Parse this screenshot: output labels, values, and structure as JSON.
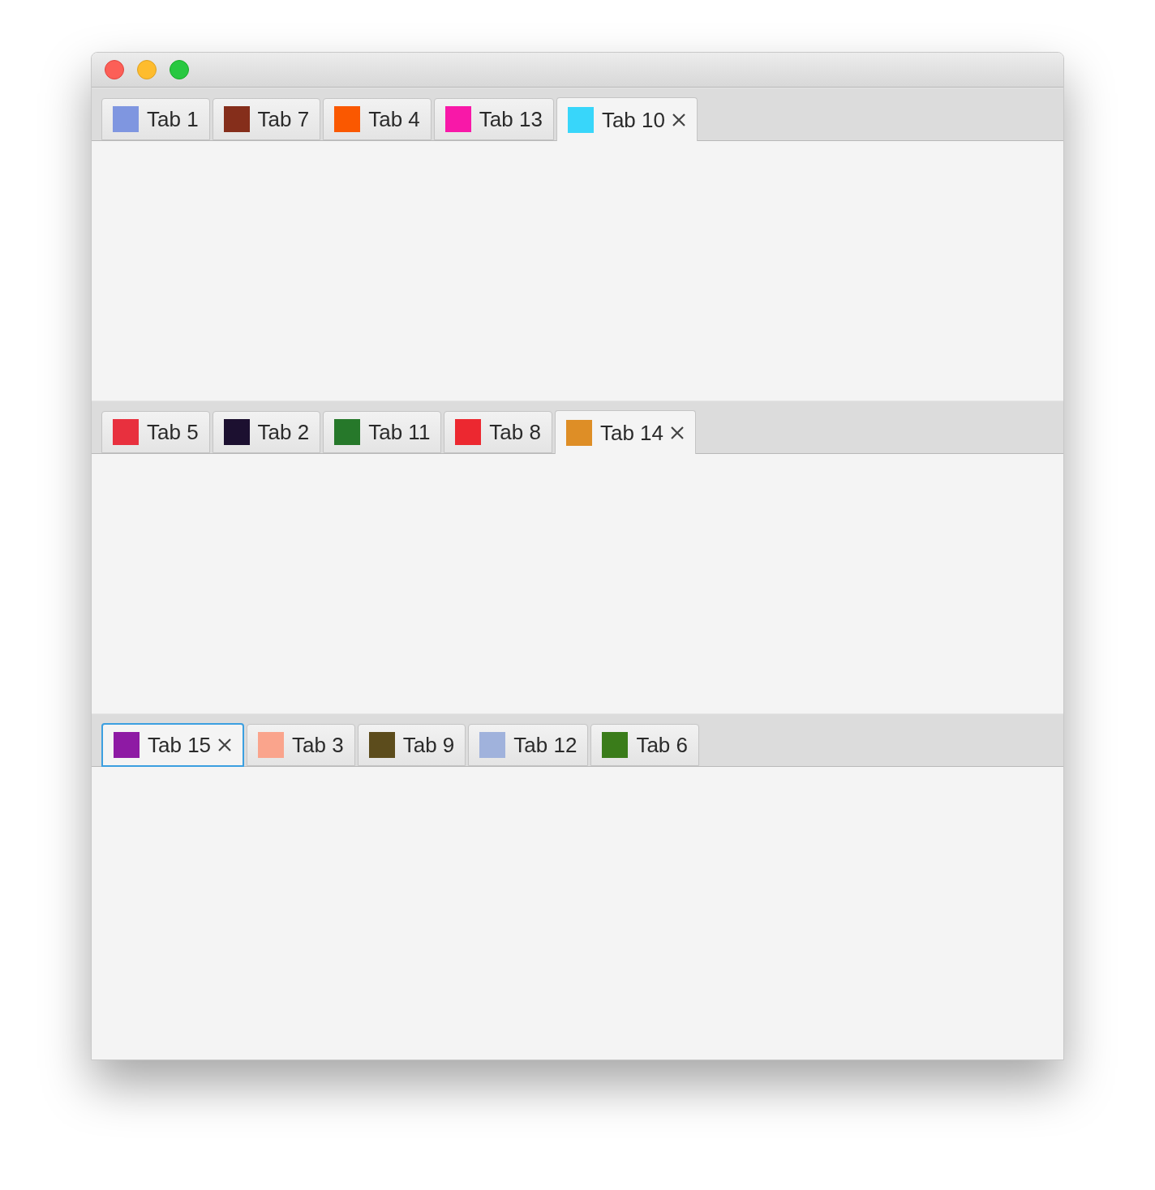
{
  "panes": [
    {
      "tabs": [
        {
          "label": "Tab 1",
          "color": "#7f96e0",
          "selected": false,
          "focused": false
        },
        {
          "label": "Tab 7",
          "color": "#852e1b",
          "selected": false,
          "focused": false
        },
        {
          "label": "Tab 4",
          "color": "#fa5800",
          "selected": false,
          "focused": false
        },
        {
          "label": "Tab 13",
          "color": "#f818a8",
          "selected": false,
          "focused": false
        },
        {
          "label": "Tab 10",
          "color": "#38d6fa",
          "selected": true,
          "focused": false
        }
      ]
    },
    {
      "tabs": [
        {
          "label": "Tab 5",
          "color": "#e8303e",
          "selected": false,
          "focused": false
        },
        {
          "label": "Tab 2",
          "color": "#1c1030",
          "selected": false,
          "focused": false
        },
        {
          "label": "Tab 11",
          "color": "#26782a",
          "selected": false,
          "focused": false
        },
        {
          "label": "Tab 8",
          "color": "#ec2830",
          "selected": false,
          "focused": false
        },
        {
          "label": "Tab 14",
          "color": "#de8e26",
          "selected": true,
          "focused": false
        }
      ]
    },
    {
      "tabs": [
        {
          "label": "Tab 15",
          "color": "#8e1aa4",
          "selected": true,
          "focused": true
        },
        {
          "label": "Tab 3",
          "color": "#faa48c",
          "selected": false,
          "focused": false
        },
        {
          "label": "Tab 9",
          "color": "#5c4c1c",
          "selected": false,
          "focused": false
        },
        {
          "label": "Tab 12",
          "color": "#a0b2dc",
          "selected": false,
          "focused": false
        },
        {
          "label": "Tab 6",
          "color": "#3a7c1a",
          "selected": false,
          "focused": false
        }
      ]
    }
  ]
}
